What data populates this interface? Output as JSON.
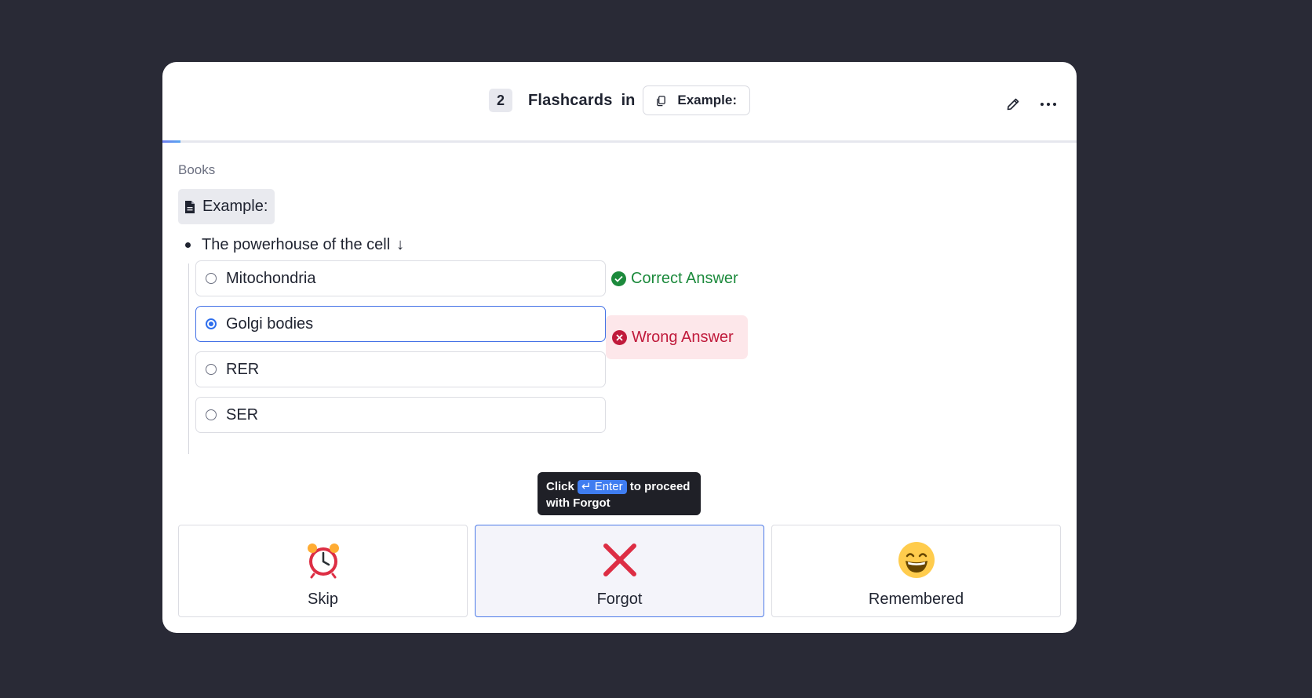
{
  "header": {
    "card_count": "2",
    "title": "Flashcards",
    "in_word": "in",
    "deck_name": "Example:",
    "progress_fraction": 0.02
  },
  "content": {
    "breadcrumb": "Books",
    "page_name": "Example:",
    "question": "The powerhouse of the cell",
    "question_arrow": "↓",
    "options": [
      {
        "label": "Mitochondria",
        "selected": false
      },
      {
        "label": "Golgi bodies",
        "selected": true
      },
      {
        "label": "RER",
        "selected": false
      },
      {
        "label": "SER",
        "selected": false
      }
    ],
    "correct_label": "Correct Answer",
    "wrong_label": "Wrong Answer"
  },
  "tooltip": {
    "click": "Click",
    "key": "↵ Enter",
    "proceed": "to proceed",
    "with_text": "with Forgot"
  },
  "actions": [
    {
      "label": "Skip",
      "icon": "alarm-clock-icon"
    },
    {
      "label": "Forgot",
      "icon": "cross-mark-icon",
      "active": true
    },
    {
      "label": "Remembered",
      "icon": "grinning-face-icon"
    }
  ],
  "colors": {
    "background": "#292a36",
    "correct": "#1c8a3c",
    "wrong": "#c01a3b",
    "accent": "#3f7df0"
  }
}
